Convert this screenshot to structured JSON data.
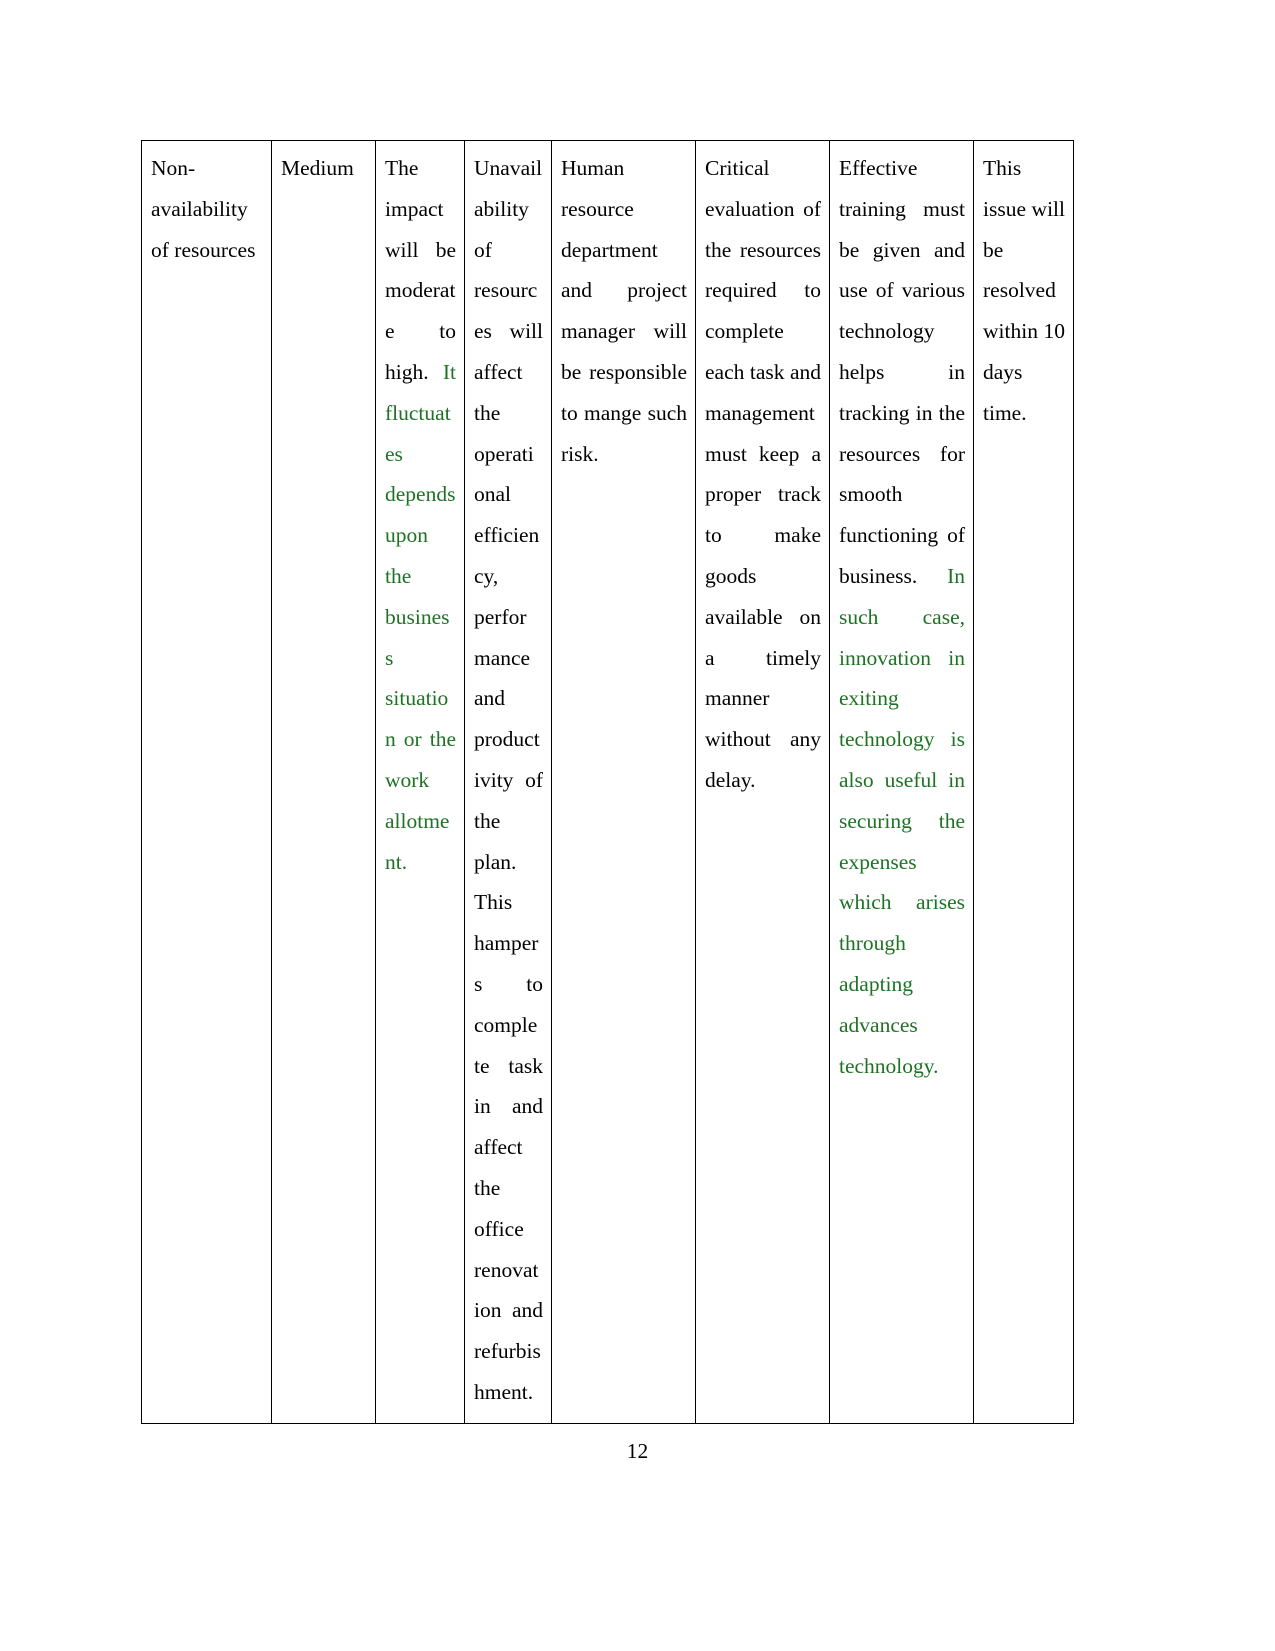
{
  "document": {
    "page_number": "12",
    "colors": {
      "text": "#000000",
      "revision_text": "#1E7224",
      "table_border": "#000000",
      "page_background": "#ffffff"
    }
  },
  "table": {
    "name": "risk-register-table",
    "columns": [
      "risk",
      "risk-level",
      "impact",
      "effect",
      "owner",
      "mitigation",
      "action",
      "timeline"
    ],
    "rows": [
      {
        "risk": "Non-availability of resources",
        "risk_level": "Medium",
        "impact_black": "The impact will be moderate to high.",
        "impact_green": "It fluctuates depends upon the business situation or the work allotment.",
        "effect": "Unavailability of resources will affect the operational efficiency, performance and productivity of the plan. This hampers to complete task in and affect the office renovation and refurbishment.",
        "owner": "Human resource department and project manager will be responsible to mange such risk.",
        "mitigation": "Critical evaluation of the resources required to complete each task and management must keep a proper track to make goods available on a timely manner without any delay.",
        "action_black": "Effective training must be given and use of various technology helps in tracking in the resources for smooth functioning of business.",
        "action_green": "In such case, innovation in exiting technology is also useful in securing the expenses which arises through adapting advances technology.",
        "timeline": "This issue will be resolved within 10 days time."
      }
    ]
  }
}
